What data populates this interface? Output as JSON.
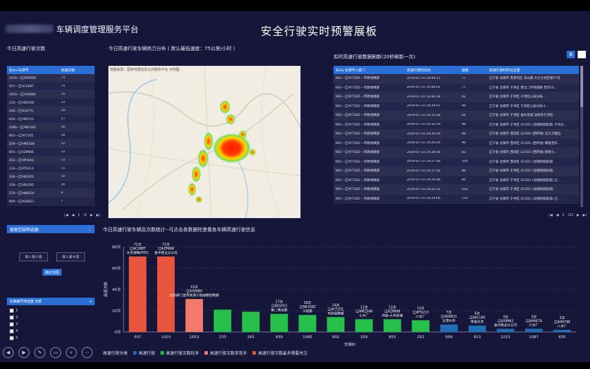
{
  "header": {
    "platform_title": "车辆调度管理服务平台",
    "main_title": "安全行驶实时预警展板"
  },
  "left_panel": {
    "title": "今日高速行驶次数",
    "columns": [
      "车id+车牌号",
      "高速次数"
    ],
    "rows": [
      [
        "1010---辽AZP668",
        "71"
      ],
      [
        "937---辽AC288T",
        "71"
      ],
      [
        "1053---辽A30080",
        "31"
      ],
      [
        "233---辽AD0546",
        "21"
      ],
      [
        "265---辽AC977L",
        "19"
      ],
      [
        "839---辽AKSY53",
        "17"
      ],
      [
        "1085---辽AB158Z",
        "16"
      ],
      [
        "902---辽AY71D1",
        "14"
      ],
      [
        "259---辽AME548",
        "12"
      ],
      [
        "855---辽AZM0I8",
        "12"
      ],
      [
        "252---辽APV0X2",
        "11"
      ],
      [
        "233---辽AT5U13",
        "11"
      ],
      [
        "334---辽AN1052",
        "10"
      ],
      [
        "256---辽ARS205",
        "10"
      ],
      [
        "274---辽AN6A20",
        "8"
      ],
      [
        "909---辽AG6821",
        "7"
      ]
    ],
    "pager": {
      "page": "1",
      "total": "/3"
    }
  },
  "filter_panel": {
    "title": "速度范围筛选器:",
    "min_placeholder": "输入最小值",
    "max_placeholder": "输入最大值",
    "confirm_label": "确定范围",
    "vehicle_select_title": "车辆编号筛选器  全部",
    "checkbox_items": [
      "1",
      "2",
      "3",
      "4",
      "5"
    ]
  },
  "map_panel": {
    "title": "今日高速行驶车辆热力分布 ( 默认最低速度：75公里/小时 )",
    "map_caption": "地图来源：国家地理信息公共服务平台 天地图"
  },
  "right_panel": {
    "title": "实时高速行驶数据刷新(20秒刷新一次)",
    "columns": [
      "车id+车牌号+部门",
      "高速行驶时间点",
      "速度",
      "高速行驶时所在位置"
    ],
    "rows": [
      [
        "902---辽AY71D1---市政保障部",
        "2019-07-31 19:49:15",
        "77",
        "辽宁省 沈阳市 苏家屯区 白山路 大力士杜匹德77号"
      ],
      [
        "902---辽AY71D1---市政保障部",
        "2019-07-31 19:48:02",
        "77",
        "辽宁省 沈阳市 于洪区 西北二环快速路 老京10..."
      ],
      [
        "902---辽AY71D1---市政保障部",
        "2019-07-31 19:46:18",
        "81",
        "辽宁省 沈阳市 于洪区 于洪区公安分局..."
      ],
      [
        "902---辽AY71D1---市政保障部",
        "2019-07-31 19:39:07",
        "80",
        "辽宁省 沈阳市 于洪区 于洪区公安分局十..."
      ],
      [
        "902---辽AY71D1---市政保障部",
        "2019-07-31 19:33:58",
        "94",
        "辽宁省 沈阳市 于洪区 金水花城 沈阳市于洪区..."
      ],
      [
        "902---辽AY71D1---市政保障部",
        "2019-07-31 19:32:29",
        "98",
        "辽宁省 沈阳市 于洪区 G1501 (沈阳绕城高速) 于洪立..."
      ],
      [
        "902---辽AY71D1---市政保障部",
        "2019-07-31 19:30:59",
        "98",
        "辽宁省 沈阳市 西郊区 G1501 (西环线) 北方大理石"
      ],
      [
        "902---辽AY71D1---市政保障部",
        "2019-07-31 19:29:29",
        "96",
        "辽宁省 沈阳市 西郊区 G1501 (西环线) 鹰家堡东..."
      ],
      [
        "902---辽AY71D1---市政保障部",
        "2019-07-31 19:28:58",
        "83",
        "辽宁省 沈阳市 西郊区 G1501 (西环线) 鹤傍小..."
      ],
      [
        "902---辽AY71D1---市政保障部",
        "2019-07-31 19:27:48",
        "100",
        "辽宁省 沈阳市 西郊区 G1501 (沈阳绕城高速)"
      ],
      [
        "902---辽AY71D1---市政保障部",
        "2019-07-31 19:27:18",
        "98",
        "辽宁省 沈阳市 于洪区 G1501 (沈阳绕城高速)"
      ],
      [
        "902---辽AY71D1---市政保障部",
        "2019-07-31 19:26:48",
        "85",
        "辽宁省 沈阳市 于洪区 G1501 (沈阳绕城高速) 辽..."
      ],
      [
        "902---辽AY71D1---市政保障部",
        "2019-07-31 19:25:32",
        "102",
        "辽宁省 沈阳市 于洪区 G1501 (沈阳绕城高速)"
      ],
      [
        "902---辽AY71D1---市政保障部",
        "2019-07-31 19:24:06",
        "110",
        "辽宁省 沈阳市 于洪区 G1501 (沈阳绕城高速) 辽..."
      ]
    ],
    "pager": {
      "page": "1",
      "total": "/22"
    }
  },
  "chart_panel": {
    "title": "今日高速行驶车辆及次数统计--可点击各数据柱查看各车辆高速行驶信息"
  },
  "chart_data": {
    "type": "bar",
    "ylabel": "高速次数",
    "xlabel": "车辆ID",
    "ylim": [
      0,
      80
    ],
    "yticks": [
      "0次",
      "20次",
      "40次",
      "60次",
      "80次"
    ],
    "categories": [
      "937",
      "1010",
      "1053",
      "233",
      "265",
      "839",
      "1085",
      "902",
      "259",
      "855",
      "252",
      "909",
      "913",
      "1015",
      "1087",
      "835"
    ],
    "values": [
      71,
      71,
      31,
      21,
      19,
      17,
      16,
      14,
      12,
      12,
      11,
      7,
      6,
      3,
      3,
      2
    ],
    "labels": [
      [
        "71次",
        "辽AC288T",
        "水务保障(P05)"
      ],
      [
        "71次",
        "辽AZP668",
        "查中营业分公司"
      ],
      [
        "31次",
        "辽A30080",
        "法务部门宣传资源工程规模控制部"
      ],
      [
        "",
        "",
        ""
      ],
      [
        "",
        "",
        ""
      ],
      [
        "17次",
        "辽AKSY53",
        "第二营业部"
      ],
      [
        "16次",
        "辽AB158Z",
        "工程部"
      ],
      [
        "14次",
        "辽AY71D1",
        "市政保障部"
      ],
      [
        "12次",
        "辽AMZ548",
        "七水厂"
      ],
      [
        "12次",
        "辽AZM0I8",
        "供查-大东新城"
      ],
      [
        "11次",
        "辽AT5U13",
        "六水厂"
      ],
      [
        "7次",
        "辽AG6821",
        "五营水务"
      ],
      [
        "6次",
        "辽A81180",
        "零查水务"
      ],
      [
        "3次",
        "辽AX8962",
        "查中营业分公司"
      ],
      [
        "3次",
        "辽AH847A",
        "六水厂"
      ],
      [
        "2次",
        "辽AH0796",
        "八水厂"
      ]
    ],
    "series_groups": [
      "高速行驶",
      "高速行驶次数较多",
      "高速行驶次数非常多",
      "高速行驶次数最多需要关注"
    ],
    "legend_title": "高速行驶分类",
    "colors": {
      "low": "#1f6fb8",
      "medium": "#26c14b",
      "high": "#f27a6b",
      "highest": "#e8553d"
    }
  }
}
